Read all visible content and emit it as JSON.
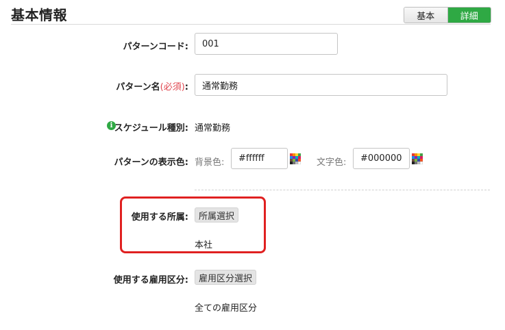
{
  "section": {
    "title": "基本情報"
  },
  "view_toggle": {
    "basic_label": "基本",
    "detail_label": "詳細"
  },
  "form": {
    "pattern_code": {
      "label": "パターンコード:",
      "value": "001"
    },
    "pattern_name": {
      "label_main": "パターン名",
      "label_required": "(必須)",
      "label_colon": ":",
      "value": "通常勤務"
    },
    "schedule_type": {
      "label": "スケジュール種別:",
      "value": "通常勤務"
    },
    "display_color": {
      "label": "パターンの表示色:",
      "bg_label": "背景色:",
      "bg_value": "#ffffff",
      "text_label": "文字色:",
      "text_value": "#000000"
    },
    "affiliation": {
      "label": "使用する所属:",
      "button_label": "所属選択",
      "value": "本社"
    },
    "employment_class": {
      "label": "使用する雇用区分:",
      "button_label": "雇用区分選択",
      "value": "全ての雇用区分"
    }
  },
  "colors": {
    "accent_green": "#2fa944",
    "required_red": "#e0464f",
    "highlight_red": "#e02020"
  }
}
